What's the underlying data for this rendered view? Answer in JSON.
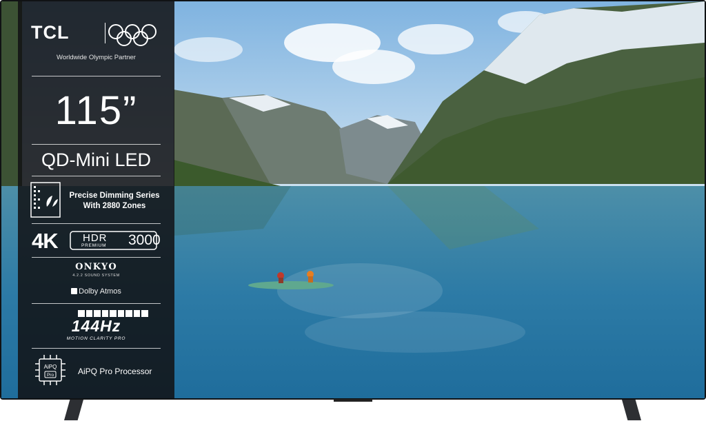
{
  "brand": {
    "name": "TCL",
    "partner": "Worldwide Olympic Partner"
  },
  "product": {
    "size": "115”",
    "technology": "QD-Mini LED",
    "dimming_line1": "Precise Dimming Series",
    "dimming_line2": "With 2880 Zones",
    "resolution": "4K",
    "hdr": "HDR",
    "hdr_premium": "PREMIUM",
    "hdr_nits": "3000",
    "audio_brand": "ONKYO",
    "audio_sub": "4.2.2 SOUND SYSTEM",
    "dolby": "Dolby Atmos",
    "refresh": "144Hz",
    "refresh_sub": "MOTION CLARITY PRO",
    "processor_badge_top": "AiPQ",
    "processor_badge_bottom": "Pro",
    "processor": "AiPQ Pro Processor"
  },
  "icons": [
    "olympic-rings-icon",
    "dimming-zones-icon",
    "dolby-icon",
    "chip-icon"
  ],
  "colors": {
    "panel": "#121214",
    "sky": "#8fc0e6",
    "lake": "#2f7fa8",
    "mountain": "#3f5a3a"
  }
}
